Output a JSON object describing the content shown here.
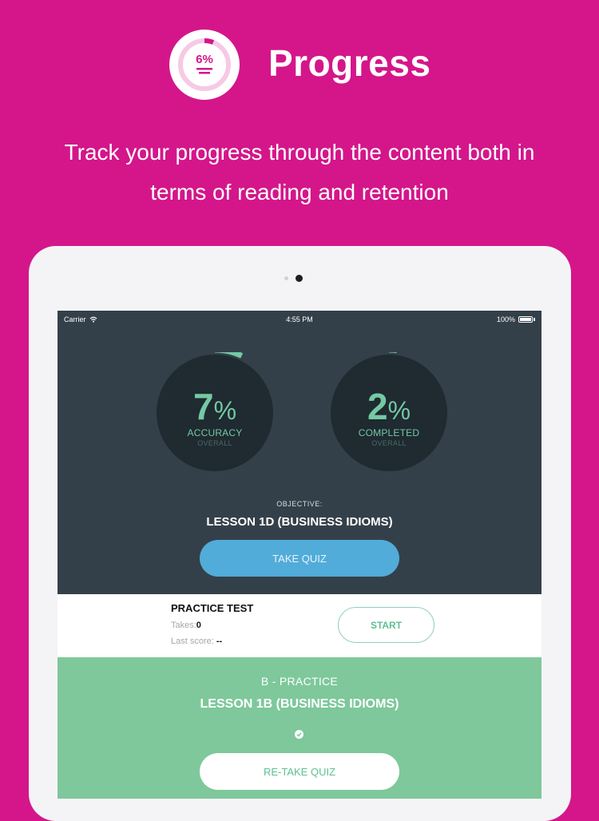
{
  "hero": {
    "logo_value": "6%",
    "title": "Progress",
    "subtitle_line1": "Track your progress through the content both in",
    "subtitle_line2": "terms of reading and retention"
  },
  "statusbar": {
    "carrier": "Carrier",
    "time": "4:55 PM",
    "battery": "100%"
  },
  "gauges": {
    "accuracy": {
      "value": "7",
      "unit": "%",
      "label": "ACCURACY",
      "sub": "OVERALL",
      "fraction": 0.07
    },
    "completed": {
      "value": "2",
      "unit": "%",
      "label": "COMPLETED",
      "sub": "OVERALL",
      "fraction": 0.02
    }
  },
  "objective": {
    "label": "OBJECTIVE:",
    "title": "LESSON 1D (BUSINESS IDIOMS)",
    "button": "TAKE QUIZ"
  },
  "practice_test": {
    "title": "PRACTICE TEST",
    "takes_label": "Takes:",
    "takes_value": "0",
    "last_score_label": "Last score:",
    "last_score_value": "--",
    "button": "START"
  },
  "b_practice": {
    "label": "B - PRACTICE",
    "title": "LESSON 1B (BUSINESS IDIOMS)",
    "button": "RE-TAKE QUIZ"
  },
  "colors": {
    "background": "#d4168a",
    "screen": "#344049",
    "accent_green": "#74c9a2",
    "button_blue": "#52acd9",
    "section_green": "#7ec89b"
  }
}
